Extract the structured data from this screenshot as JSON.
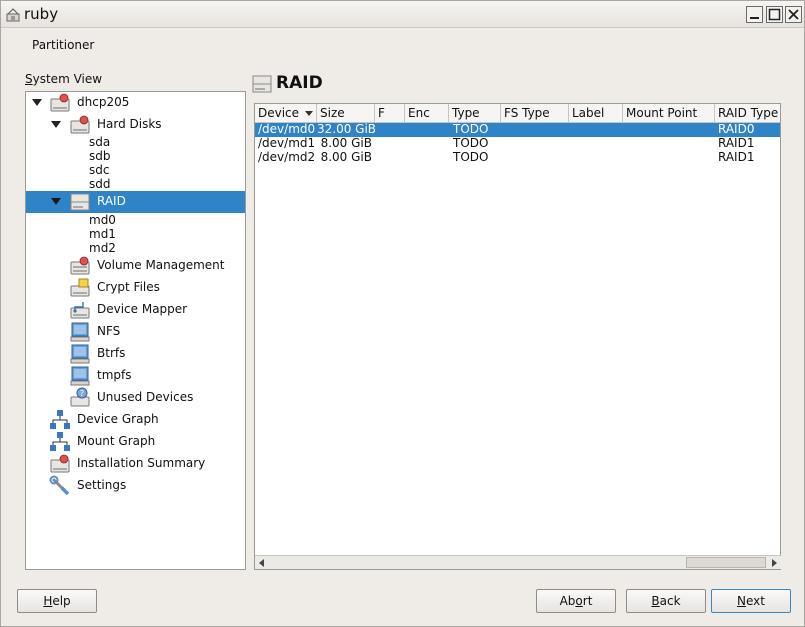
{
  "window": {
    "title": "ruby"
  },
  "header": {
    "partitioner": "Partitioner"
  },
  "system_view": {
    "label_underline": "S",
    "label_rest": "ystem View",
    "tree": {
      "root": "dhcp205",
      "hard_disks": "Hard Disks",
      "disks": [
        "sda",
        "sdb",
        "sdc",
        "sdd"
      ],
      "raid": "RAID",
      "raid_items": [
        "md0",
        "md1",
        "md2"
      ],
      "volume_management": "Volume Management",
      "crypt_files": "Crypt Files",
      "device_mapper": "Device Mapper",
      "nfs": "NFS",
      "btrfs": "Btrfs",
      "tmpfs": "tmpfs",
      "unused_devices": "Unused Devices",
      "device_graph": "Device Graph",
      "mount_graph": "Mount Graph",
      "installation_summary": "Installation Summary",
      "settings": "Settings"
    }
  },
  "main": {
    "title": "RAID",
    "columns": [
      "Device",
      "Size",
      "F",
      "Enc",
      "Type",
      "FS Type",
      "Label",
      "Mount Point",
      "RAID Type"
    ],
    "rows": [
      {
        "device": "/dev/md0",
        "size": "32.00 GiB",
        "type": "TODO",
        "raid_type": "RAID0"
      },
      {
        "device": "/dev/md1",
        "size": "8.00 GiB",
        "type": "TODO",
        "raid_type": "RAID1"
      },
      {
        "device": "/dev/md2",
        "size": "8.00 GiB",
        "type": "TODO",
        "raid_type": "RAID1"
      }
    ]
  },
  "buttons": {
    "help": {
      "ul": "H",
      "rest": "elp"
    },
    "abort": {
      "pre": "Ab",
      "ul": "o",
      "rest": "rt"
    },
    "back": {
      "ul": "B",
      "rest": "ack"
    },
    "next": {
      "ul": "N",
      "rest": "ext"
    }
  },
  "colors": {
    "selection": "#2f84c7",
    "window_bg": "#efebe7",
    "default_button_border": "#3d86c6"
  }
}
